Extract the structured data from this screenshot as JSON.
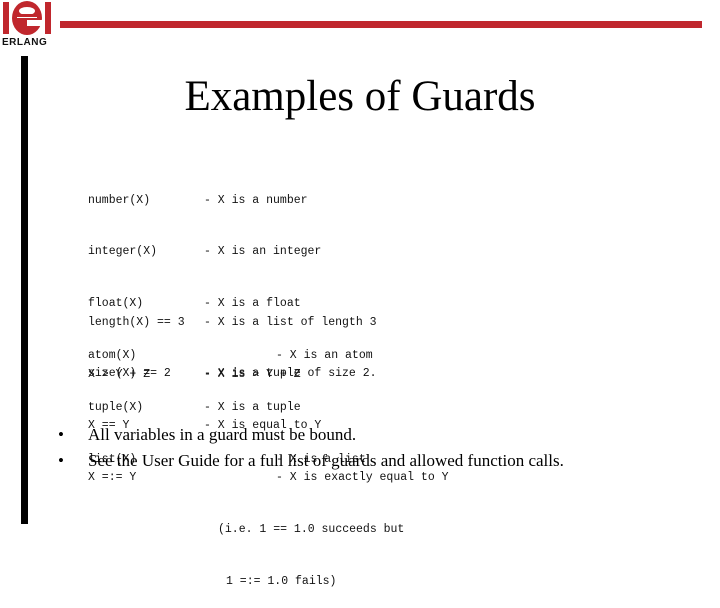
{
  "logo": {
    "text": "ERLANG",
    "color": "#c0272d"
  },
  "title": "Examples of Guards",
  "guards": {
    "group1": [
      {
        "expr": "number(X)",
        "desc": "- X is a number"
      },
      {
        "expr": "integer(X)",
        "desc": "- X is an integer"
      },
      {
        "expr": "float(X)",
        "desc": "- X is a float"
      },
      {
        "expr": "atom(X)",
        "desc": "- X is an atom"
      },
      {
        "expr": "tuple(X)",
        "desc": "- X is a tuple"
      },
      {
        "expr": "list(X)",
        "desc": "- X is a list"
      }
    ],
    "group2": [
      {
        "expr": "length(X) == 3",
        "desc": "- X is a list of length 3"
      },
      {
        "expr": "size(X) == 2",
        "desc": "- X is a tuple of size 2."
      }
    ],
    "group3": [
      {
        "expr": "X > Y + Z",
        "desc": "- X is > Y + Z"
      },
      {
        "expr": "X == Y",
        "desc": "- X is equal to Y"
      },
      {
        "expr": "X =:= Y",
        "desc": "- X is exactly equal to Y"
      }
    ],
    "note_line1": "(i.e. 1 == 1.0 succeeds but",
    "note_line2": "1 =:= 1.0 fails)"
  },
  "bullets": [
    "All variables in a guard must be bound.",
    "See the User Guide for a full list of guards and allowed function calls."
  ],
  "bullet_glyph": "•"
}
